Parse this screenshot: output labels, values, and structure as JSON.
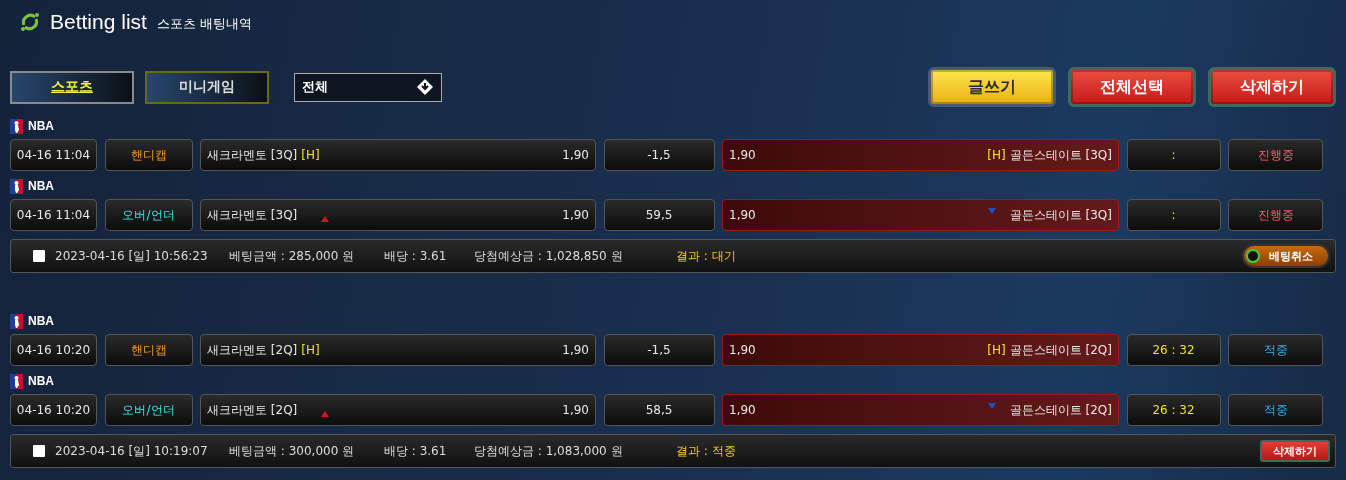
{
  "header": {
    "title": "Betting list",
    "subtitle": "스포츠 배팅내역"
  },
  "tabs": [
    {
      "label": "스포츠",
      "selected": true
    },
    {
      "label": "미니게임",
      "selected": false
    }
  ],
  "filter": {
    "value": "전체"
  },
  "action_buttons": [
    {
      "label": "글쓰기",
      "kind": "yellow"
    },
    {
      "label": "전체선택",
      "kind": "red"
    },
    {
      "label": "삭제하기",
      "kind": "red"
    }
  ],
  "bets": [
    {
      "games": [
        {
          "league": "NBA",
          "time": "04-16 11:04",
          "market": "핸디캡",
          "kind": "handicap",
          "home": "새크라멘토 [3Q]",
          "home_tag": "[H]",
          "home_odds": "1,90",
          "line": "-1,5",
          "away_odds": "1,90",
          "away_tag": "[H]",
          "away": "골든스테이트 [3Q]",
          "score": ":",
          "status": {
            "label": "진행중",
            "kind": "pending"
          }
        },
        {
          "league": "NBA",
          "time": "04-16 11:04",
          "market": "오버/언더",
          "kind": "overunder",
          "home": "새크라멘토 [3Q]",
          "home_odds": "1,90",
          "line": "59,5",
          "away_odds": "1,90",
          "away": "골든스테이트 [3Q]",
          "score": ":",
          "status": {
            "label": "진행중",
            "kind": "pending"
          }
        }
      ],
      "summary": {
        "checked": false,
        "datetime": "2023-04-16 [일] 10:56:23",
        "amount": "베팅금액 : 285,000 원",
        "odds": "배당 : 3.61",
        "payout": "당첨예상금 : 1,028,850 원",
        "result": "결과 : 대기",
        "action": {
          "label": "베팅취소",
          "kind": "cancel"
        }
      }
    },
    {
      "games": [
        {
          "league": "NBA",
          "time": "04-16 10:20",
          "market": "핸디캡",
          "kind": "handicap",
          "home": "새크라멘토 [2Q]",
          "home_tag": "[H]",
          "home_odds": "1,90",
          "line": "-1,5",
          "away_odds": "1,90",
          "away_tag": "[H]",
          "away": "골든스테이트 [2Q]",
          "score": "26 : 32",
          "status": {
            "label": "적중",
            "kind": "won"
          }
        },
        {
          "league": "NBA",
          "time": "04-16 10:20",
          "market": "오버/언더",
          "kind": "overunder",
          "home": "새크라멘토 [2Q]",
          "home_odds": "1,90",
          "line": "58,5",
          "away_odds": "1,90",
          "away": "골든스테이트 [2Q]",
          "score": "26 : 32",
          "status": {
            "label": "적중",
            "kind": "won"
          }
        }
      ],
      "summary": {
        "checked": false,
        "datetime": "2023-04-16 [일] 10:19:07",
        "amount": "베팅금액 : 300,000 원",
        "odds": "배당 : 3.61",
        "payout": "당첨예상금 : 1,083,000 원",
        "result": "결과 : 적중",
        "action": {
          "label": "삭제하기",
          "kind": "delete"
        }
      }
    }
  ]
}
